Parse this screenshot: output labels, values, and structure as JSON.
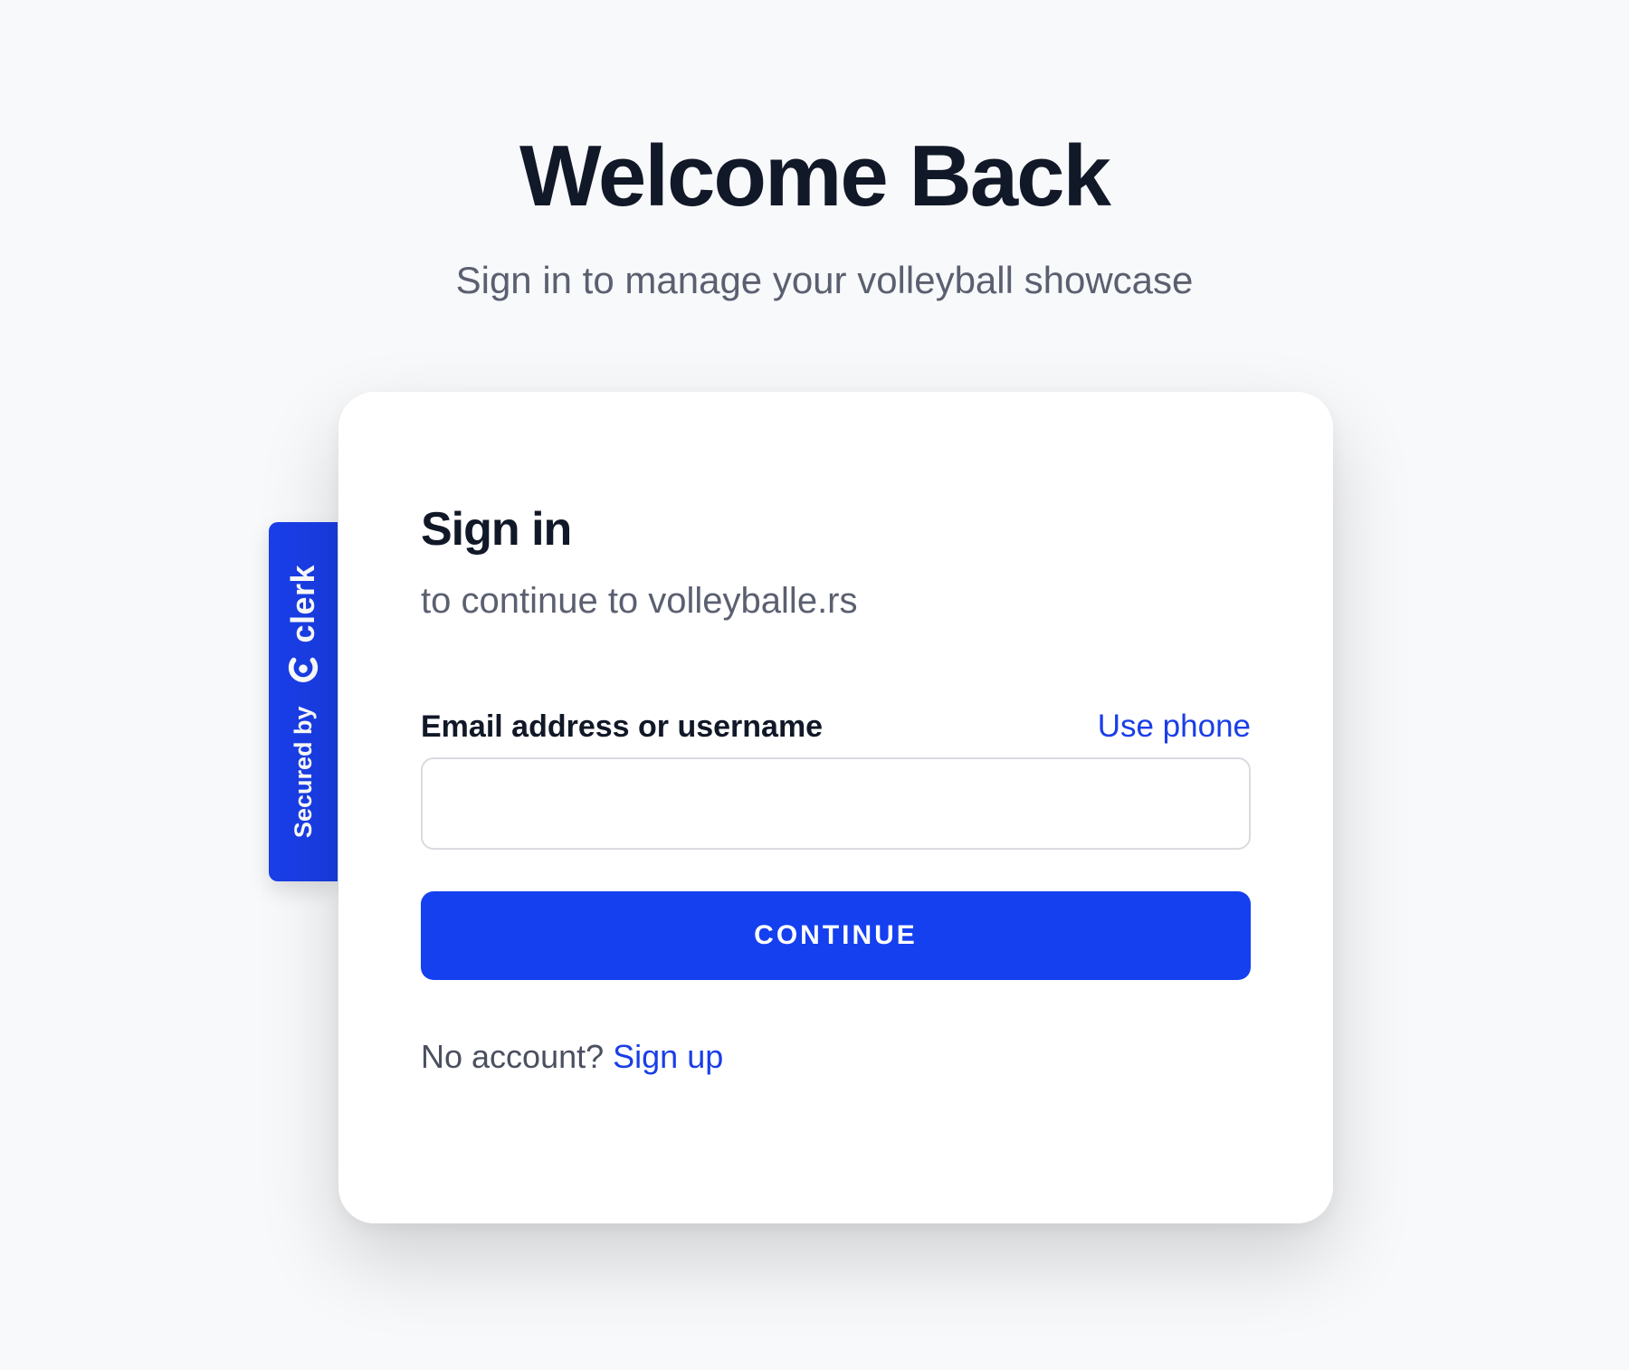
{
  "header": {
    "title": "Welcome Back",
    "subtitle": "Sign in to manage your volleyball showcase"
  },
  "badge": {
    "secured_by": "Secured by",
    "brand": "clerk"
  },
  "card": {
    "title": "Sign in",
    "subtitle": "to continue to volleyballe.rs",
    "email_label": "Email address or username",
    "use_phone": "Use phone",
    "email_value": "",
    "continue_label": "CONTINUE",
    "no_account": "No account?",
    "sign_up": "Sign up"
  },
  "colors": {
    "accent": "#1440f0",
    "link": "#1a3ee8",
    "background": "#f8f9fb",
    "heading": "#111827",
    "muted": "#5b6070"
  }
}
